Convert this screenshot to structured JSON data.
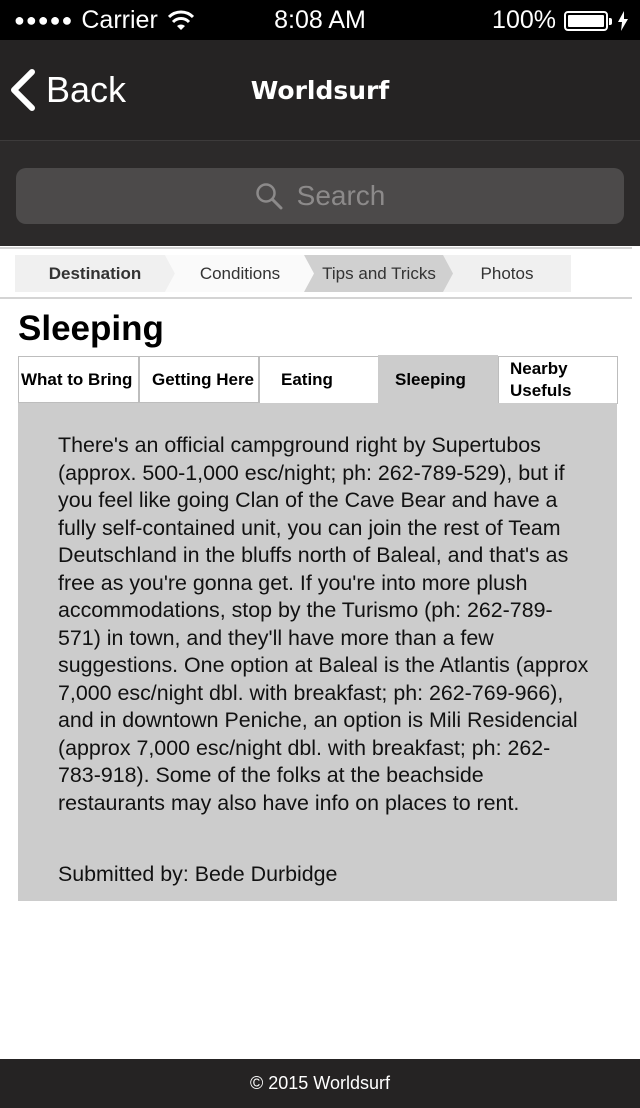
{
  "status_bar": {
    "carrier": "Carrier",
    "time": "8:08 AM",
    "battery": "100%",
    "battery_level": 1.0,
    "signal_bars": 5
  },
  "nav": {
    "back_label": "Back",
    "title": "Worldsurf"
  },
  "search": {
    "placeholder": "Search"
  },
  "breadcrumb_tabs": [
    {
      "label": "Destination",
      "state": "current"
    },
    {
      "label": "Conditions",
      "state": "normal"
    },
    {
      "label": "Tips and Tricks",
      "state": "selected"
    },
    {
      "label": "Photos",
      "state": "normal"
    }
  ],
  "page_title": "Sleeping",
  "sub_tabs": [
    {
      "label": "What to Bring",
      "active": false
    },
    {
      "label": "Getting Here",
      "active": false
    },
    {
      "label": "Eating",
      "active": false
    },
    {
      "label": "Sleeping",
      "active": true
    },
    {
      "label": "Nearby Usefuls",
      "active": false
    }
  ],
  "content": {
    "text": "There's an official campground right by Supertubos (approx. 500-1,000 esc/night; ph: 262-789-529), but if you feel like going Clan of the Cave Bear and have a fully self-contained unit, you can join the rest of Team Deutschland in the bluffs north of Baleal, and that's as free as you're gonna get. If you're into more plush accommodations, stop by the Turismo (ph: 262-789-571) in town, and they'll have more than a few suggestions. One option at Baleal is the Atlantis (approx 7,000 esc/night dbl. with breakfast; ph: 262-769-966), and in downtown Peniche, an option is Mili Residencial (approx 7,000 esc/night dbl. with breakfast; ph: 262-783-918). Some of the folks at the beachside restaurants may also have info on places to rent.",
    "submitted_by": "Submitted by: Bede Durbidge"
  },
  "footer": {
    "copyright": "© 2015 Worldsurf"
  },
  "colors": {
    "nav_bg": "#252323",
    "search_bg": "#2c2a2a",
    "search_field": "#4c4a4a",
    "content_bg": "#cccccc",
    "crumb_current": "#f0f0f0",
    "crumb_selected": "#d0d0d0"
  },
  "icons": {
    "back": "chevron-left-icon",
    "search": "magnifier-icon",
    "wifi": "wifi-icon",
    "battery": "battery-icon",
    "charging": "bolt-icon"
  }
}
